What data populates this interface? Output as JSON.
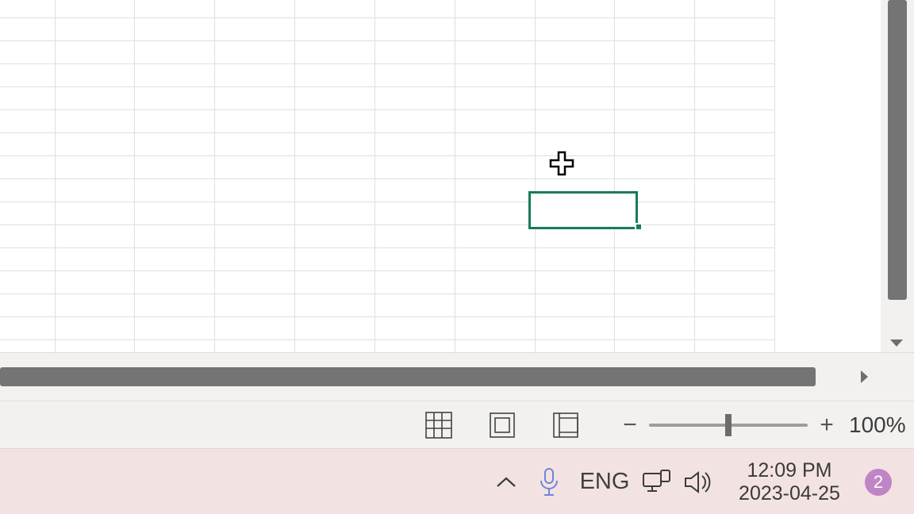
{
  "status": {
    "zoom_value": "100%"
  },
  "taskbar": {
    "language": "ENG",
    "time": "12:09 PM",
    "date": "2023-04-25",
    "notifications": "2"
  }
}
